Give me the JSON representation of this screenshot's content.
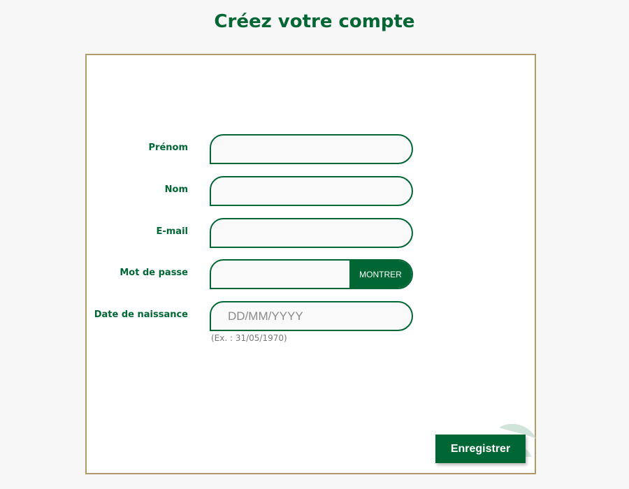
{
  "page": {
    "title": "Créez votre compte"
  },
  "form": {
    "first_name": {
      "label": "Prénom",
      "placeholder": "",
      "value": ""
    },
    "last_name": {
      "label": "Nom",
      "placeholder": "",
      "value": ""
    },
    "email": {
      "label": "E-mail",
      "placeholder": "",
      "value": ""
    },
    "password": {
      "label": "Mot de passe",
      "placeholder": "",
      "value": "",
      "show_label": "MONTRER"
    },
    "birth_date": {
      "label": "Date de naissance",
      "placeholder": "DD/MM/YYYY",
      "value": "",
      "hint": "(Ex. : 31/05/1970)"
    },
    "submit_label": "Enregistrer"
  },
  "colors": {
    "brand_green": "#006633",
    "card_border": "#b09a6a",
    "background": "#f7f7f7"
  },
  "icons": {
    "decoration": "leaf-decoration-icon"
  }
}
